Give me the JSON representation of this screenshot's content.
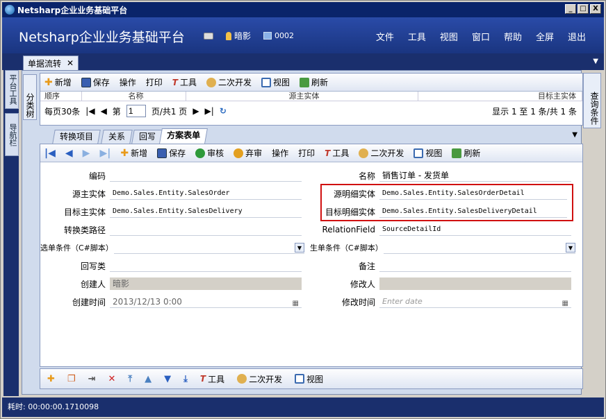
{
  "window": {
    "title": "Netsharp企业业务基础平台",
    "min": "_",
    "max": "□",
    "close": "X"
  },
  "header": {
    "app_title": "Netsharp企业业务基础平台",
    "user": "暗影",
    "terminal": "0002",
    "menus": [
      "文件",
      "工具",
      "视图",
      "窗口",
      "帮助",
      "全屏",
      "退出"
    ]
  },
  "doc_tab": {
    "label": "单据流转",
    "close": "✕"
  },
  "left_tabs": [
    "平台工具",
    "导航栏"
  ],
  "side_tab": "分类树",
  "right_tab": "查询条件",
  "toolbar1": [
    "新增",
    "保存",
    "操作",
    "打印",
    "工具",
    "二次开发",
    "视图",
    "刷新"
  ],
  "grid_cols": [
    "顺序",
    "名称",
    "源主实体",
    "目标主实体"
  ],
  "pager": {
    "page_size": "每页30条",
    "page_label": "第",
    "page": "1",
    "total": "页/共1 页",
    "summary": "显示 1 至 1 条/共 1 条"
  },
  "tabs": [
    "转换项目",
    "关系",
    "回写",
    "方案表单"
  ],
  "toolbar2": [
    "新增",
    "保存",
    "审核",
    "弃审",
    "操作",
    "打印",
    "工具",
    "二次开发",
    "视图",
    "刷新"
  ],
  "form": {
    "code_label": "编码",
    "code": "",
    "name_label": "名称",
    "name": "销售订单 - 发货单",
    "src_main_label": "源主实体",
    "src_main": "Demo.Sales.Entity.SalesOrder",
    "src_detail_label": "源明细实体",
    "src_detail": "Demo.Sales.Entity.SalesOrderDetail",
    "tgt_main_label": "目标主实体",
    "tgt_main": "Demo.Sales.Entity.SalesDelivery",
    "tgt_detail_label": "目标明细实体",
    "tgt_detail": "Demo.Sales.Entity.SalesDeliveryDetail",
    "path_label": "转换类路径",
    "path": "",
    "relation_label": "RelationField",
    "relation": "SourceDetailId",
    "select_cond_label": "选单条件（C#脚本）",
    "select_cond": "",
    "gen_cond_label": "生单条件（C#脚本）",
    "gen_cond": "",
    "writeback_label": "回写类",
    "writeback": "",
    "remark_label": "备注",
    "remark": "",
    "creator_label": "创建人",
    "creator": "暗影",
    "modifier_label": "修改人",
    "modifier": "",
    "created_label": "创建时间",
    "created": "2013/12/13 0:00",
    "modified_label": "修改时间",
    "modified_placeholder": "Enter date"
  },
  "toolbar3": [
    "工具",
    "二次开发",
    "视图"
  ],
  "status": "耗时: 00:00:00.1710098"
}
